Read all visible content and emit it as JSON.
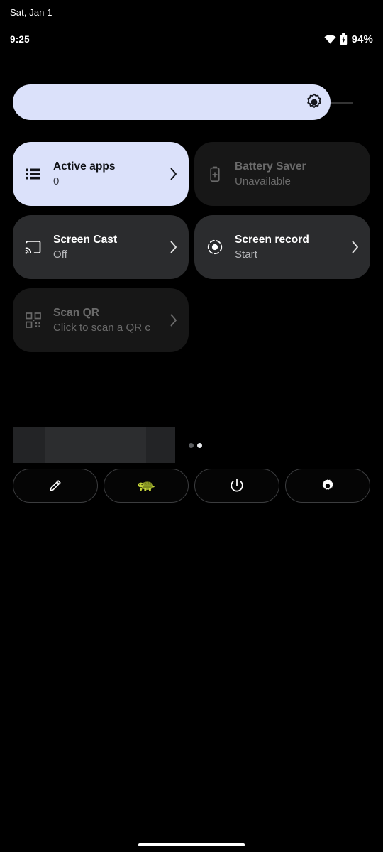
{
  "status_bar": {
    "date": "Sat, Jan 1",
    "clock": "9:25",
    "battery_percent": "94%",
    "wifi_icon": "wifi-icon",
    "battery_icon": "battery-charging-icon"
  },
  "brightness": {
    "name": "brightness-slider",
    "icon": "brightness-sun-icon",
    "value_percent": 93,
    "fill_color": "#dbe1fa",
    "track_color": "#343434"
  },
  "tiles": [
    {
      "id": "active-apps",
      "title": "Active apps",
      "subtitle": "0",
      "state": "active",
      "icon": "list-icon",
      "chevron": true,
      "bg": "#dbe1fa"
    },
    {
      "id": "battery-saver",
      "title": "Battery Saver",
      "subtitle": "Unavailable",
      "state": "disabled",
      "icon": "battery-saver-icon",
      "chevron": false,
      "bg": "#171717"
    },
    {
      "id": "screen-cast",
      "title": "Screen Cast",
      "subtitle": "Off",
      "state": "inactive",
      "icon": "cast-icon",
      "chevron": true,
      "bg": "#2b2c2e"
    },
    {
      "id": "screen-record",
      "title": "Screen record",
      "subtitle": "Start",
      "state": "inactive",
      "icon": "record-icon",
      "chevron": true,
      "bg": "#2b2c2e"
    },
    {
      "id": "scan-qr",
      "title": "Scan QR",
      "subtitle": "Click to scan a QR c",
      "state": "disabled",
      "icon": "qr-code-icon",
      "chevron": true,
      "bg": "#171717"
    }
  ],
  "pager": {
    "total": 2,
    "active_index": 1
  },
  "footer": {
    "buttons": [
      {
        "id": "edit",
        "icon": "pencil-icon",
        "label": ""
      },
      {
        "id": "user",
        "icon": "turtle-avatar-icon",
        "label": ""
      },
      {
        "id": "power",
        "icon": "power-icon",
        "label": ""
      },
      {
        "id": "settings",
        "icon": "gear-icon",
        "label": ""
      }
    ]
  },
  "nav": {
    "gesture_bar": "home-gesture-bar"
  }
}
